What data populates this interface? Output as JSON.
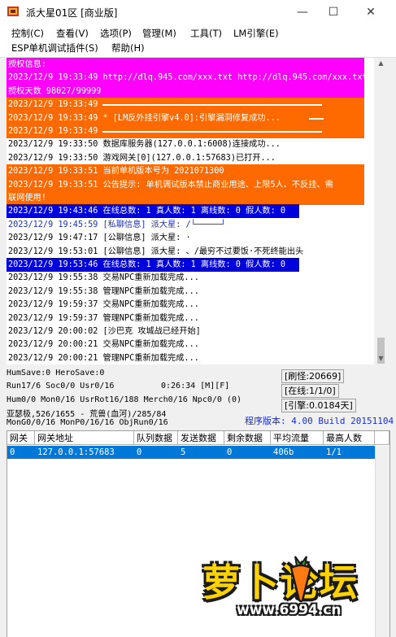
{
  "window": {
    "title": "派大星01区 [商业版]",
    "minimize_glyph": "—",
    "maximize_glyph": "☐",
    "close_glyph": "✕"
  },
  "menu": {
    "items": [
      "控制(C)",
      "查看(V)",
      "选项(P)",
      "管理(M)",
      "工具(T)",
      "LM引擎(E)",
      "ESP单机调试插件(S)",
      "帮助(H)"
    ]
  },
  "log": {
    "lines": [
      {
        "text": "授权信息:",
        "style": "magenta"
      },
      {
        "text": "2023/12/9 19:33:49 http://dlq.945.com/xxx.txt http://dlq.945.com/xxx.txt",
        "style": "magenta"
      },
      {
        "text": "授权天数 98027/99999",
        "style": "magenta"
      },
      {
        "text": "2023/12/9 19:33:49 ",
        "style": "orange"
      },
      {
        "text": "2023/12/9 19:33:49 * [LM反外挂引擎v4.0]:引擎漏洞修复成功...",
        "style": "orange"
      },
      {
        "text": "2023/12/9 19:33:49 ",
        "style": "orange"
      },
      {
        "text": "2023/12/9 19:33:50 数据库服务器(127.0.0.1:6008)连接成功...",
        "style": "black"
      },
      {
        "text": "2023/12/9 19:33:50 游戏网关[0](127.0.0.1:57683)已打开...",
        "style": "black"
      },
      {
        "text": "2023/12/9 19:33:51 当前单机版本号为 2021071300",
        "style": "orange"
      },
      {
        "text": "2023/12/9 19:33:51 公告提示: 单机调试版本禁止商业用途、上限5人、不反挂、需",
        "style": "orange"
      },
      {
        "text": "联网使用!",
        "style": "orange"
      },
      {
        "text": "2023/12/9 19:43:46 在线总数: 1 真人数: 1 离线数: 0 假人数: 0",
        "style": "blue"
      },
      {
        "text": "2023/12/9 19:45:59 [私聊信息] 派大星: /└─────┘",
        "style": "fgblue"
      },
      {
        "text": "2023/12/9 19:47:17 [公聊信息] 派大星: ·",
        "style": "black"
      },
      {
        "text": "2023/12/9 19:53:01 [公聊信息] 派大星: 、/最穷不过要饭·不死终能出头",
        "style": "black"
      },
      {
        "text": "2023/12/9 19:53:46 在线总数: 1 真人数: 1 离线数: 0 假人数: 0",
        "style": "blue"
      },
      {
        "text": "2023/12/9 19:55:38 交易NPC重新加载完成...",
        "style": "black"
      },
      {
        "text": "2023/12/9 19:55:38 管理NPC重新加载完成...",
        "style": "black"
      },
      {
        "text": "2023/12/9 19:59:37 交易NPC重新加载完成...",
        "style": "black"
      },
      {
        "text": "2023/12/9 19:59:37 管理NPC重新加载完成...",
        "style": "black"
      },
      {
        "text": "2023/12/9 20:00:02 [沙巴克 攻城战已经开始]",
        "style": "black"
      },
      {
        "text": "2023/12/9 20:00:21 交易NPC重新加载完成...",
        "style": "black"
      },
      {
        "text": "2023/12/9 20:00:21 管理NPC重新加载完成...",
        "style": "black"
      }
    ]
  },
  "status": {
    "line1": "HumSave:0 HeroSave:0",
    "line2": "Run17/6 Soc0/0 Usr0/16",
    "time": "0:26:34 [M][F]",
    "line3": "Hum0/0 Mon0/16 UsrRot16/188 Merch0/16 Npc0/0 (0)",
    "line4": "亚瑟极,526/1655 - 荒兽(血河)/285/84",
    "line5": "MonG0/0/16 MonP0/16/16 ObjRun0/16",
    "refresh": "[刷怪:20669]",
    "online": "[在线:1/1/0]",
    "engine": "[引擎:0.0184天]",
    "version": "程序版本: 4.00 Build 20151104"
  },
  "table": {
    "headers": [
      "网关",
      "网关地址",
      "队列数据",
      "发送数据",
      "剩余数据",
      "平均流量",
      "最高人数"
    ],
    "rows": [
      [
        "0",
        "127.0.0.1:57683",
        "0",
        "5",
        "0",
        "406b",
        "1/1"
      ]
    ]
  },
  "watermark": {
    "text": "萝卜论坛",
    "url": "www.6994.cn"
  },
  "colors": {
    "magenta": "#ff00ff",
    "orange": "#ff6a00",
    "blue": "#0000dd",
    "selection": "#0078d7",
    "version_text": "#1a2ec8"
  }
}
